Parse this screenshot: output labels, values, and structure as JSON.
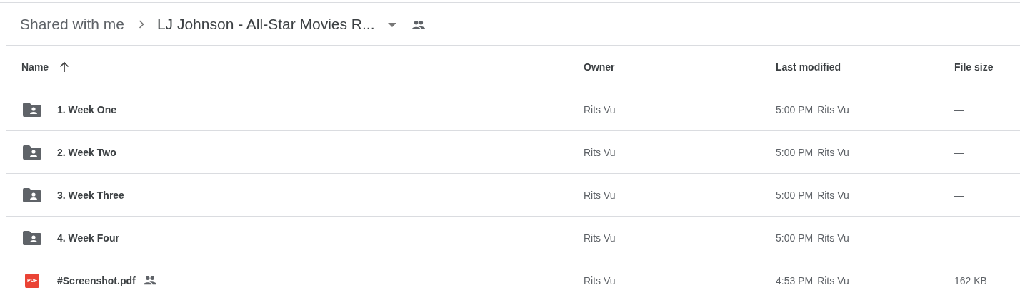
{
  "breadcrumb": {
    "items": [
      "Shared with me",
      "LJ Johnson - All-Star Movies R..."
    ],
    "has_dropdown": true,
    "shared": true
  },
  "table": {
    "columns": [
      {
        "label": "Name",
        "sorted": true
      },
      {
        "label": "Owner",
        "sorted": false
      },
      {
        "label": "Last modified",
        "sorted": false
      },
      {
        "label": "File size",
        "sorted": false
      }
    ],
    "rows": [
      {
        "kind": "shared-folder",
        "name": "1. Week One",
        "shared": false,
        "owner": "Rits Vu",
        "modified_time": "5:00 PM",
        "modified_by": "Rits Vu",
        "size": "—"
      },
      {
        "kind": "shared-folder",
        "name": "2. Week Two",
        "shared": false,
        "owner": "Rits Vu",
        "modified_time": "5:00 PM",
        "modified_by": "Rits Vu",
        "size": "—"
      },
      {
        "kind": "shared-folder",
        "name": "3. Week Three",
        "shared": false,
        "owner": "Rits Vu",
        "modified_time": "5:00 PM",
        "modified_by": "Rits Vu",
        "size": "—"
      },
      {
        "kind": "shared-folder",
        "name": "4. Week Four",
        "shared": false,
        "owner": "Rits Vu",
        "modified_time": "5:00 PM",
        "modified_by": "Rits Vu",
        "size": "—"
      },
      {
        "kind": "pdf",
        "icon_label": "PDF",
        "name": "#Screenshot.pdf",
        "shared": true,
        "owner": "Rits Vu",
        "modified_time": "4:53 PM",
        "modified_by": "Rits Vu",
        "size": "162 KB"
      }
    ]
  }
}
